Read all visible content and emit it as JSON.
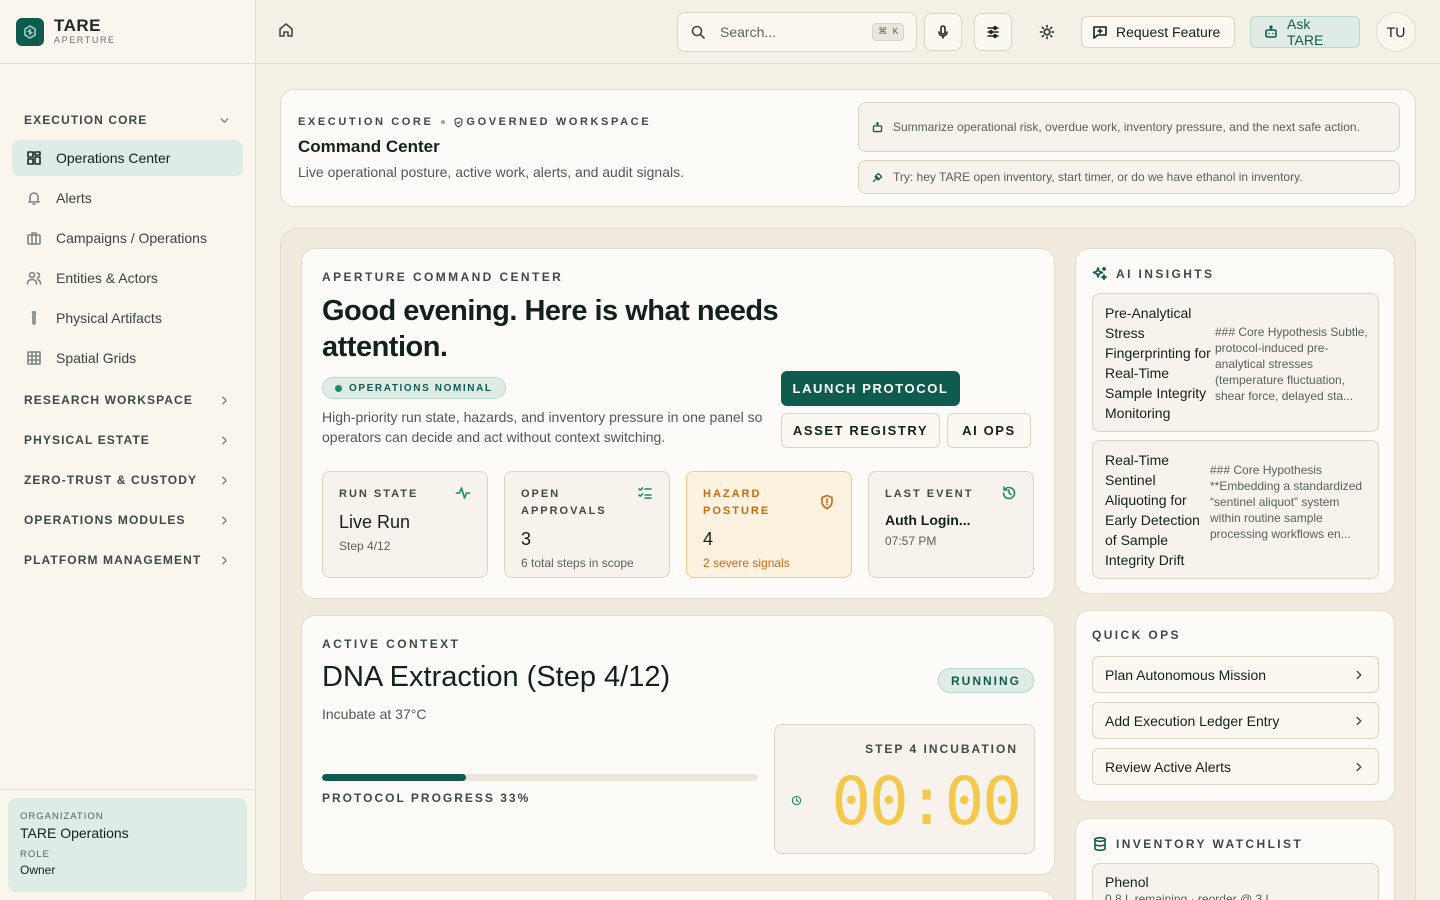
{
  "brand": {
    "name": "TARE",
    "sub": "APERTURE"
  },
  "sidebar": {
    "section_core": "EXECUTION CORE",
    "items": [
      {
        "label": "Operations Center",
        "icon": "dashboard-icon"
      },
      {
        "label": "Alerts",
        "icon": "bell-icon"
      },
      {
        "label": "Campaigns / Operations",
        "icon": "briefcase-icon"
      },
      {
        "label": "Entities & Actors",
        "icon": "users-icon"
      },
      {
        "label": "Physical Artifacts",
        "icon": "test-tube-icon"
      },
      {
        "label": "Spatial Grids",
        "icon": "grid-icon"
      }
    ],
    "sections": [
      "RESEARCH WORKSPACE",
      "PHYSICAL ESTATE",
      "ZERO-TRUST & CUSTODY",
      "OPERATIONS MODULES",
      "PLATFORM MANAGEMENT"
    ]
  },
  "org": {
    "org_label": "ORGANIZATION",
    "org_name": "TARE Operations",
    "role_label": "ROLE",
    "role": "Owner"
  },
  "topbar": {
    "search_placeholder": "Search...",
    "shortcut": "⌘ K",
    "request_label": "Request Feature",
    "ask_label": "Ask TARE",
    "avatar": "TU"
  },
  "header": {
    "crumb1": "EXECUTION CORE",
    "crumb2": "GOVERNED WORKSPACE",
    "title": "Command Center",
    "subtitle": "Live operational posture, active work, alerts, and audit signals.",
    "hint1": "Summarize operational risk, overdue work, inventory pressure, and the next safe action.",
    "hint2": "Try: hey TARE open inventory, start timer, or do we have ethanol in inventory."
  },
  "command": {
    "eyebrow": "APERTURE COMMAND CENTER",
    "greeting": "Good evening. Here is what needs attention.",
    "status": "OPERATIONS NOMINAL",
    "description": "High-priority run state, hazards, and inventory pressure in one panel so operators can decide and act without context switching.",
    "launch": "LAUNCH PROTOCOL",
    "registry": "ASSET REGISTRY",
    "aiops": "AI OPS",
    "stats": [
      {
        "label": "RUN STATE",
        "value": "Live Run",
        "detail": "Step 4/12",
        "icon": "activity-icon"
      },
      {
        "label": "OPEN APPROVALS",
        "value": "3",
        "detail": "6 total steps in scope",
        "icon": "checklist-icon"
      },
      {
        "label": "HAZARD POSTURE",
        "value": "4",
        "detail": "2 severe signals",
        "icon": "shield-alert-icon"
      },
      {
        "label": "LAST EVENT",
        "value": "Auth Login...",
        "detail": "07:57 PM",
        "icon": "history-icon"
      }
    ]
  },
  "context": {
    "eyebrow": "ACTIVE CONTEXT",
    "title": "DNA Extraction (Step 4/12)",
    "step": "Incubate at 37°C",
    "badge": "RUNNING",
    "progress": 33,
    "progress_label": "PROTOCOL PROGRESS 33%",
    "timer_label": "STEP 4 INCUBATION",
    "timer": "00:00"
  },
  "ai": {
    "title": "AI INSIGHTS",
    "insights": [
      {
        "title": "Pre-Analytical Stress Fingerprinting for Real-Time Sample Integrity Monitoring",
        "body": "### Core Hypothesis Subtle, protocol-induced pre-analytical stresses (temperature fluctuation, shear force, delayed sta..."
      },
      {
        "title": "Real-Time Sentinel Aliquoting for Early Detection of Sample Integrity Drift",
        "body": "### Core Hypothesis **Embedding a standardized “sentinel aliquot” system within routine sample processing workflows en..."
      }
    ]
  },
  "quickops": {
    "title": "QUICK OPS",
    "items": [
      "Plan Autonomous Mission",
      "Add Execution Ledger Entry",
      "Review Active Alerts"
    ]
  },
  "inventory": {
    "title": "INVENTORY WATCHLIST",
    "items": [
      {
        "name": "Phenol",
        "meta": "0.8 L remaining · reorder @ 3 L"
      }
    ]
  }
}
